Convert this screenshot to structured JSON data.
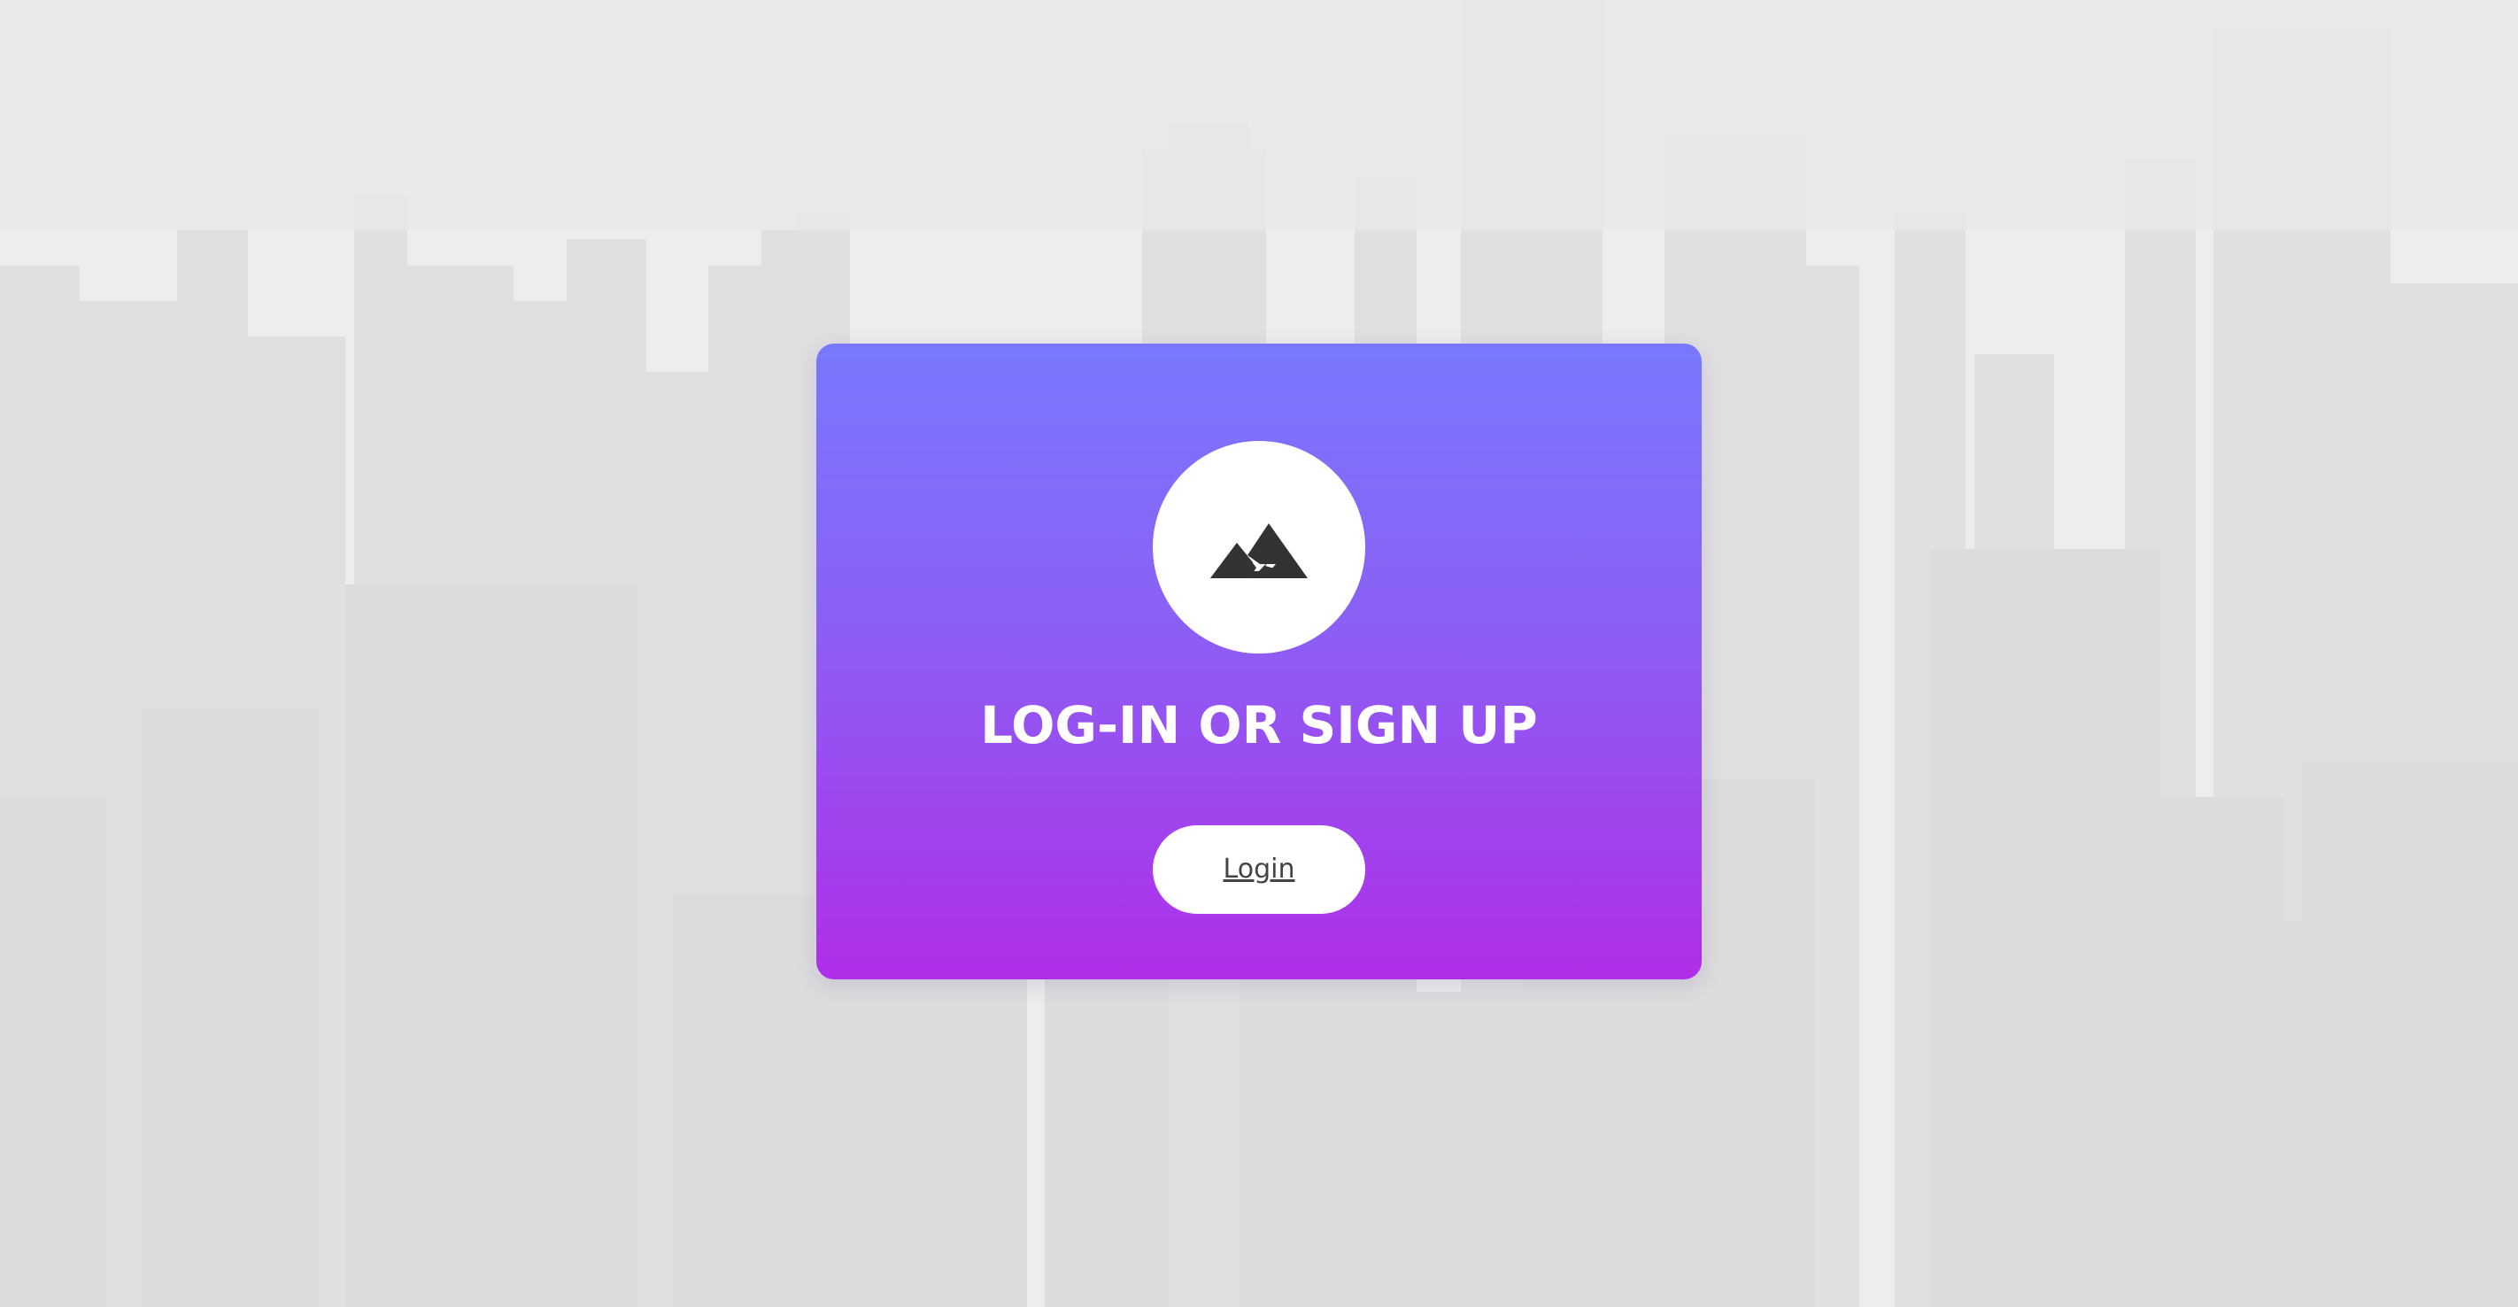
{
  "background": {
    "description_colors": {
      "sky": "#eceded",
      "buildings": "#d9d9d9"
    }
  },
  "card": {
    "gradient_top": "#7878fd",
    "gradient_bottom": "#b02ee9",
    "logo_icon": "mountain-icon",
    "heading": "LOG-IN OR SIGN UP",
    "login_label": "Login"
  }
}
